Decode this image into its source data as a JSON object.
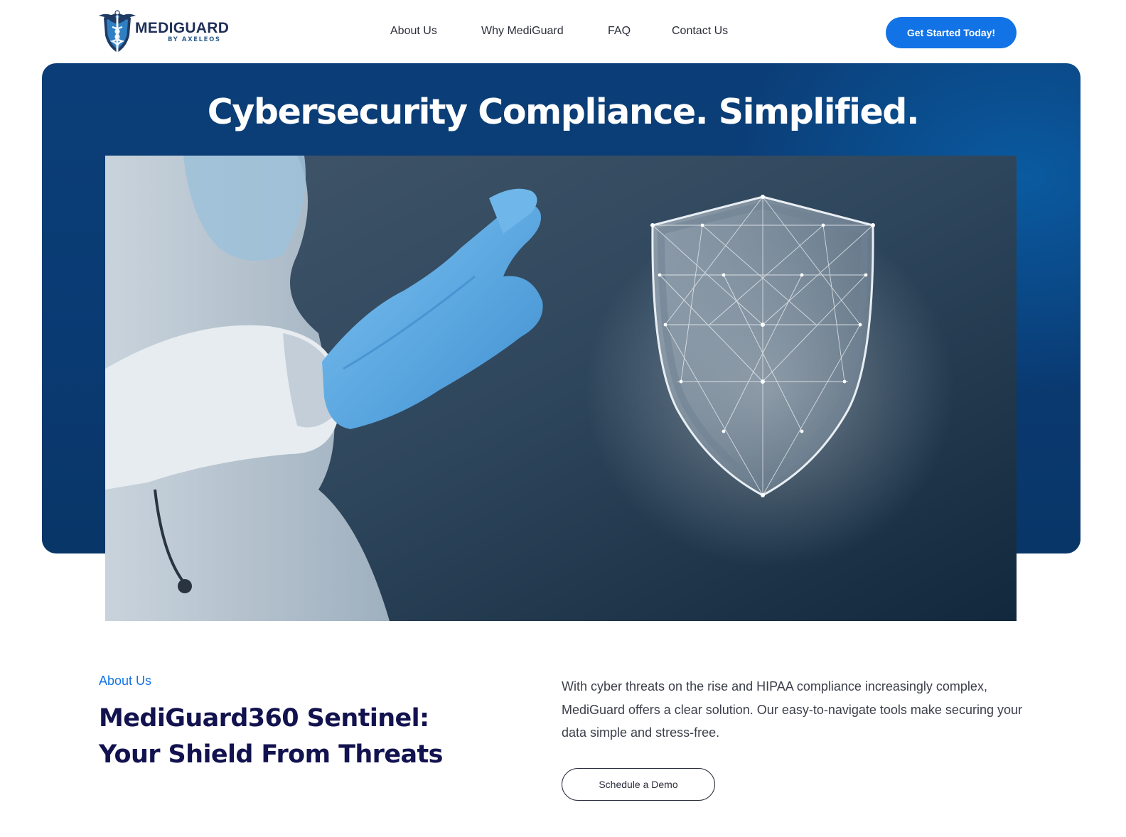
{
  "header": {
    "logo": {
      "name": "MEDIGUARD",
      "subtitle": "BY AXELEOS",
      "icon": "caduceus-shield-icon"
    },
    "nav": [
      {
        "label": "About Us"
      },
      {
        "label": "Why MediGuard"
      },
      {
        "label": "FAQ"
      },
      {
        "label": "Contact Us"
      }
    ],
    "cta_label": "Get Started Today!"
  },
  "hero": {
    "title": "Cybersecurity Compliance. Simplified.",
    "image": "gloved-hand-touching-digital-shield-image"
  },
  "about": {
    "eyebrow": "About Us",
    "heading": "MediGuard360 Sentinel: Your Shield From Threats",
    "body": "With cyber threats on the rise and HIPAA compliance increasingly complex, MediGuard offers a clear solution. Our easy-to-navigate tools make securing your data simple and stress-free.",
    "demo_label": "Schedule a Demo"
  },
  "colors": {
    "accent": "#1273e6",
    "hero_bg": "#0b3e78",
    "heading": "#12124f"
  }
}
